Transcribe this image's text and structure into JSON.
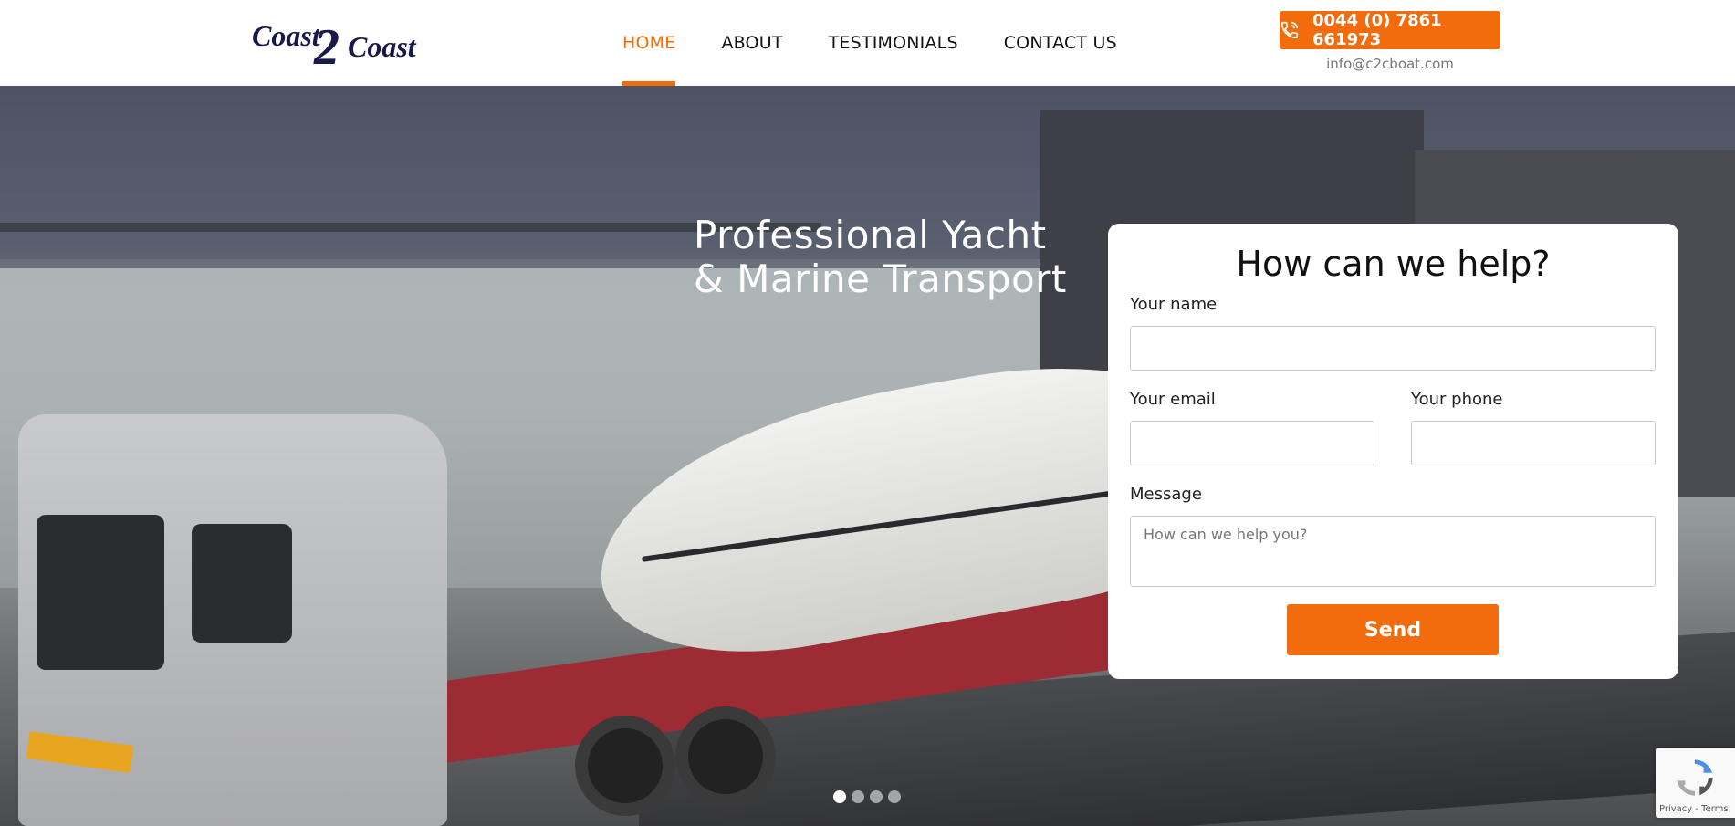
{
  "header": {
    "logo_text": "Coast 2 Coast",
    "nav": [
      {
        "label": "HOME",
        "active": true
      },
      {
        "label": "ABOUT",
        "active": false
      },
      {
        "label": "TESTIMONIALS",
        "active": false
      },
      {
        "label": "CONTACT US",
        "active": false
      }
    ],
    "phone": "0044 (0) 7861 661973",
    "email": "info@c2cboat.com"
  },
  "hero": {
    "title_line1": "Professional Yacht",
    "title_line2": "& Marine Transport",
    "slides": 4,
    "active_slide": 1
  },
  "form": {
    "title": "How can we help?",
    "name_label": "Your name",
    "email_label": "Your email",
    "phone_label": "Your phone",
    "message_label": "Message",
    "message_placeholder": "How can we help you?",
    "send_label": "Send"
  },
  "recaptcha": {
    "links": "Privacy - Terms"
  },
  "colors": {
    "accent": "#f26c0d",
    "logo": "#1a1a4a"
  }
}
